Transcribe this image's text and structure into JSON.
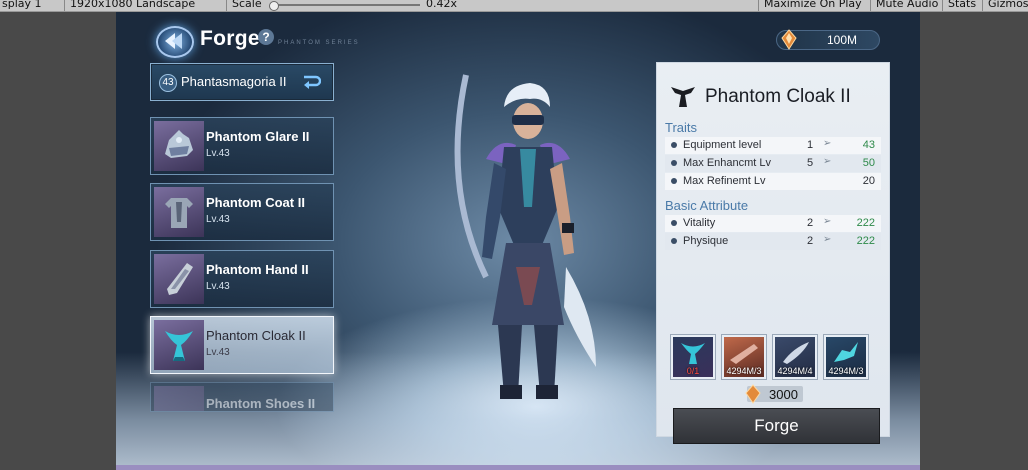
{
  "editor": {
    "display": "splay 1",
    "resolution": "1920x1080 Landscape",
    "scale_label": "Scale",
    "scale_value": "0.42x",
    "maximize": "Maximize On Play",
    "mute": "Mute Audio",
    "stats": "Stats",
    "gizmos": "Gizmos"
  },
  "header": {
    "title": "Forge",
    "help": "?",
    "subtitle_en": "PHANTOM SERIES",
    "currency": "100M"
  },
  "set": {
    "level": "43",
    "name": "Phantasmagoria II"
  },
  "items": [
    {
      "name": "Phantom Glare II",
      "level": "Lv.43"
    },
    {
      "name": "Phantom Coat II",
      "level": "Lv.43"
    },
    {
      "name": "Phantom Hand II",
      "level": "Lv.43"
    },
    {
      "name": "Phantom Cloak II",
      "level": "Lv.43"
    },
    {
      "name": "Phantom Shoes II",
      "level": ""
    }
  ],
  "panel": {
    "title": "Phantom Cloak II",
    "traits_title": "Traits",
    "traits": [
      {
        "label": "Equipment level",
        "current": "1",
        "next": "43"
      },
      {
        "label": "Max Enhancmt Lv",
        "current": "5",
        "next": "50"
      },
      {
        "label": "Max Refinemt Lv",
        "current": "",
        "next": "20"
      }
    ],
    "basic_title": "Basic Attribute",
    "basic": [
      {
        "label": "Vitality",
        "current": "2",
        "next": "222"
      },
      {
        "label": "Physique",
        "current": "2",
        "next": "222"
      }
    ],
    "materials": [
      {
        "count": "0/1"
      },
      {
        "count": "4294M/3"
      },
      {
        "count": "4294M/4"
      },
      {
        "count": "4294M/3"
      }
    ],
    "cost": "3000",
    "forge_button": "Forge"
  },
  "colors": {
    "accent_blue": "#4a7aa8",
    "upgrade_green": "#2e8a4a",
    "insufficient_red": "#ff4a3c"
  }
}
